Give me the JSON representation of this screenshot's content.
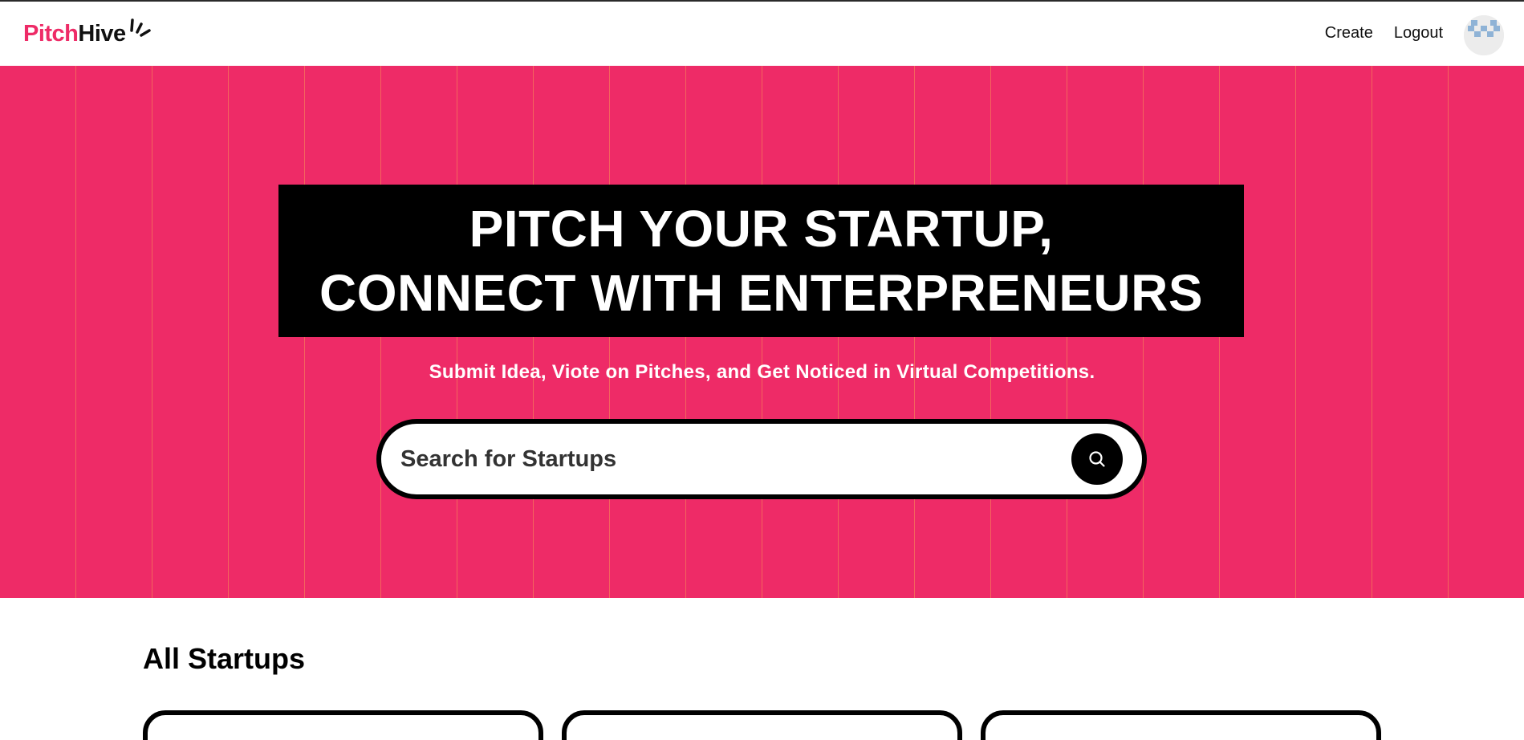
{
  "brand": {
    "part1": "Pitch",
    "part2": "Hive",
    "accent_color": "#ee2b67"
  },
  "nav": {
    "links": [
      "Create",
      "Logout"
    ],
    "avatar_icon": "avatar-pattern-icon"
  },
  "hero": {
    "headline_line1": "PITCH YOUR STARTUP,",
    "headline_line2": "CONNECT WITH ENTERPRENEURS",
    "subtitle": "Submit Idea, Viote on Pitches, and Get Noticed in Virtual Competitions.",
    "background_color": "#ee2b67"
  },
  "search": {
    "placeholder": "Search for Startups",
    "button_icon": "search-icon"
  },
  "section": {
    "title": "All Startups"
  },
  "cards": [
    {},
    {},
    {}
  ]
}
